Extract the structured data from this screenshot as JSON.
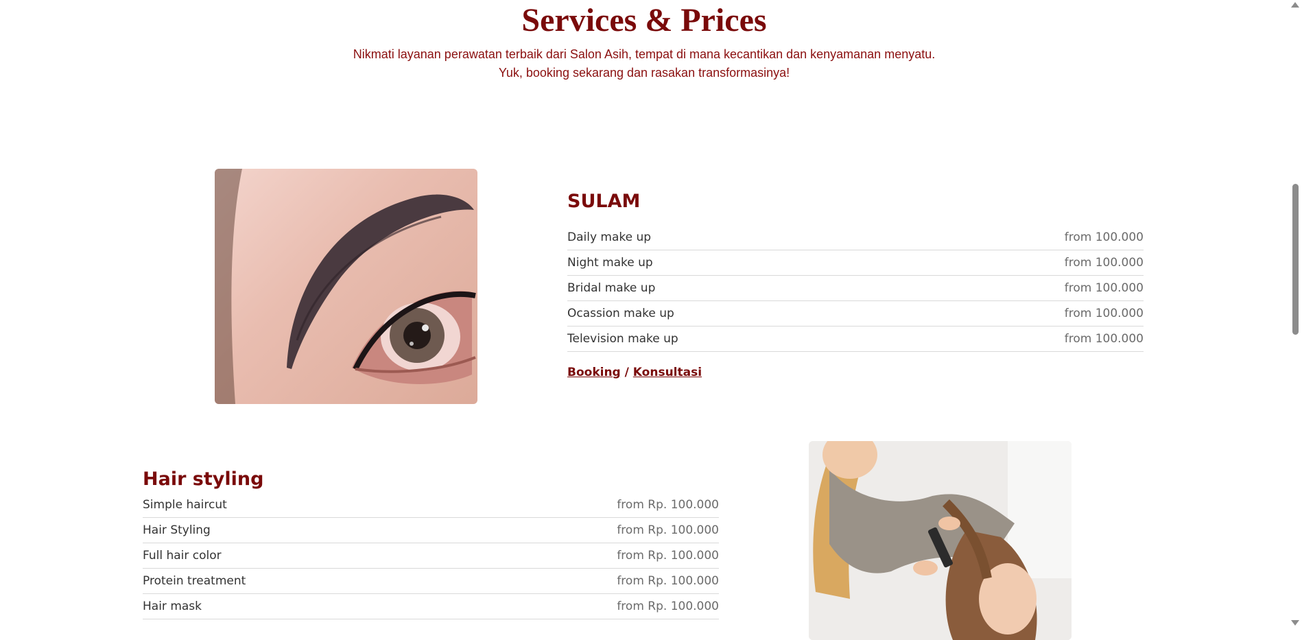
{
  "hero": {
    "title": "Services & Prices",
    "subtitle_line1": "Nikmati layanan perawatan terbaik dari Salon Asih, tempat di mana kecantikan dan kenyamanan menyatu.",
    "subtitle_line2": "Yuk, booking sekarang dan rasakan transformasinya!"
  },
  "sulam": {
    "heading": "SULAM",
    "items": [
      {
        "name": "Daily make up",
        "price": "from 100.000"
      },
      {
        "name": "Night make up",
        "price": "from 100.000"
      },
      {
        "name": "Bridal make up",
        "price": "from 100.000"
      },
      {
        "name": "Ocassion make up",
        "price": "from 100.000"
      },
      {
        "name": "Television make up",
        "price": "from 100.000"
      }
    ],
    "booking_label": "Booking",
    "separator": "/",
    "consult_label": "Konsultasi"
  },
  "hair": {
    "heading": "Hair styling",
    "items": [
      {
        "name": "Simple haircut",
        "price": "from Rp. 100.000"
      },
      {
        "name": "Hair Styling",
        "price": "from Rp. 100.000"
      },
      {
        "name": "Full hair color",
        "price": "from Rp. 100.000"
      },
      {
        "name": "Protein treatment",
        "price": "from Rp. 100.000"
      },
      {
        "name": "Hair mask",
        "price": "from Rp. 100.000"
      }
    ]
  },
  "colors": {
    "brand": "#7a0a0a",
    "subtitle": "#8b1010",
    "text": "#333333",
    "price": "#6b6b6b"
  }
}
